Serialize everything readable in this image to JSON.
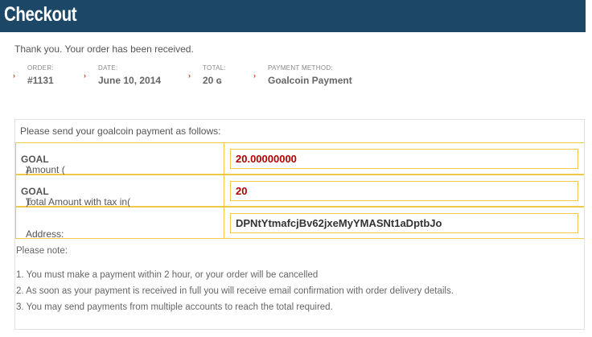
{
  "header": {
    "title": "Checkout"
  },
  "thanks": "Thank you. Your order has been received.",
  "order_summary": [
    {
      "label": "ORDER:",
      "value": "#1131"
    },
    {
      "label": "DATE:",
      "value": "June 10, 2014"
    },
    {
      "label": "TOTAL:",
      "value": "20 ɢ"
    },
    {
      "label": "PAYMENT METHOD:",
      "value": "Goalcoin Payment"
    }
  ],
  "payment": {
    "heading": "Please send your goalcoin payment as follows:",
    "rows": [
      {
        "label_prefix": "Amount (",
        "label_bold": "GOAL",
        "label_suffix": "):",
        "value": "20.00000000"
      },
      {
        "label_prefix": "Total Amount with tax in(",
        "label_bold": "GOAL",
        "label_suffix": "):",
        "value": "20"
      },
      {
        "label_prefix": "Address:",
        "label_bold": "",
        "label_suffix": "",
        "value": "DPNtYtmafcjBv62jxeMyYMASNt1aDptbJo"
      }
    ],
    "note_heading": "Please note:",
    "notes": [
      "1.  You must make a payment within 2 hour, or your order will be cancelled",
      "2.  As soon as your payment is received in full you will receive email confirmation with order delivery details.",
      "3.  You may send payments from multiple accounts to reach the total required."
    ]
  },
  "colors": {
    "header_bg": "#1c4766",
    "accent_red": "#b30000",
    "field_border": "#f0c84a"
  }
}
